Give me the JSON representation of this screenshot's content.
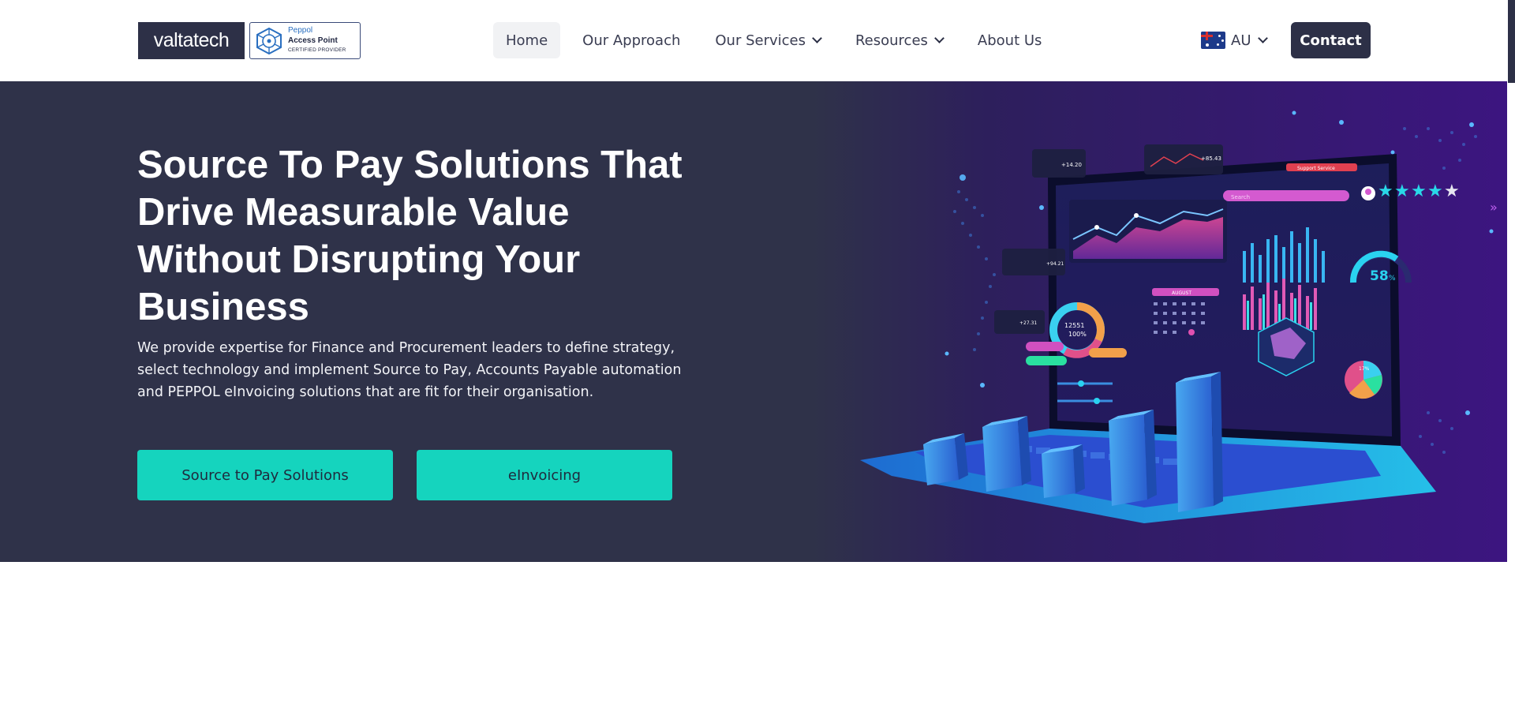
{
  "brand": {
    "logo_text": "valtatech",
    "badge_line1": "Peppol",
    "badge_line2": "Access Point",
    "badge_line3": "CERTIFIED PROVIDER"
  },
  "nav": {
    "items": [
      {
        "label": "Home",
        "active": true
      },
      {
        "label": "Our Approach"
      },
      {
        "label": "Our Services",
        "dropdown": true
      },
      {
        "label": "Resources",
        "dropdown": true
      },
      {
        "label": "About Us"
      }
    ]
  },
  "locale": {
    "label": "AU",
    "flag": "australia-flag"
  },
  "contact": {
    "label": "Contact"
  },
  "hero": {
    "title": "Source To Pay Solutions That Drive Measurable Value Without Disrupting Your Business",
    "subtitle": "We provide expertise for Finance and Procurement leaders to define strategy, select technology and implement Source to Pay, Accounts Payable automation and PEPPOL eInvoicing solutions that are fit for their organisation.",
    "cta_primary": "Source to Pay Solutions",
    "cta_secondary": "eInvoicing",
    "illustration": {
      "stat_main": "12551",
      "stat_pct": "100%",
      "gauge_value": "58",
      "gauge_unit": "%",
      "pie_pct": "17%",
      "calendar_month": "AUGUST",
      "tag_left": "+14.20",
      "tag_right": "+85.43",
      "tag_small1": "+94.21",
      "tag_small2": "+27.31",
      "search_placeholder": "Search",
      "support_label": "Support Service"
    }
  },
  "colors": {
    "header_bg": "#ffffff",
    "brand_dark": "#2d3047",
    "hero_bg": "#2f3249",
    "accent_teal": "#15d4be",
    "art_purple": "#3a1a78"
  }
}
